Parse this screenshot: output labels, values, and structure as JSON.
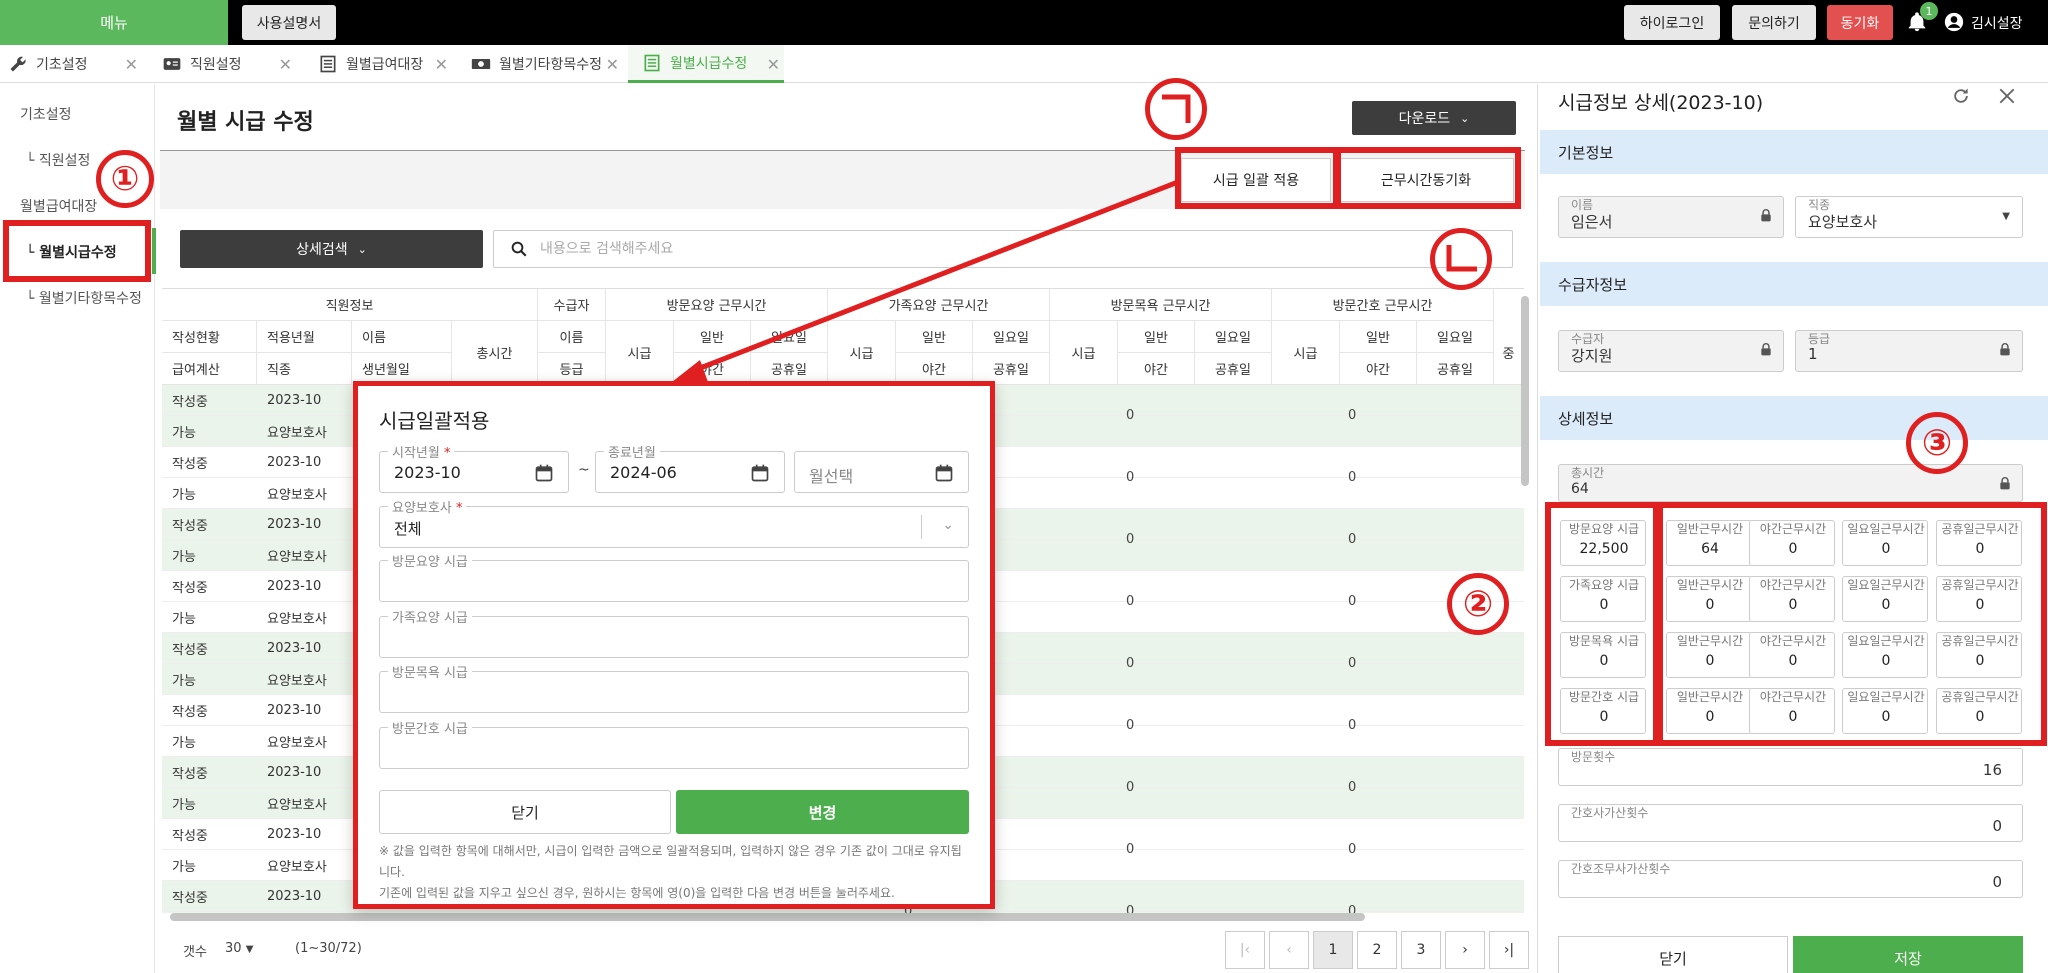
{
  "topbar": {
    "menu_label": "메뉴",
    "manual_label": "사용설명서",
    "hilogin_label": "하이로그인",
    "inquiry_label": "문의하기",
    "sync_label": "동기화",
    "notif_count": "1",
    "user_name": "김시설장",
    "colors": {
      "accent": "#5cb85c",
      "danger": "#e25050",
      "bar": "#000000"
    }
  },
  "tabs": [
    {
      "label": "기초설정",
      "icon": "wrench-icon"
    },
    {
      "label": "직원설정",
      "icon": "id-card-icon"
    },
    {
      "label": "월별급여대장",
      "icon": "ledger-icon"
    },
    {
      "label": "월별기타항목수정",
      "icon": "money-icon"
    },
    {
      "label": "월별시급수정",
      "icon": "list-icon",
      "active": true
    }
  ],
  "sidebar": {
    "items": [
      {
        "label": "기초설정"
      },
      {
        "label": "└ 직원설정"
      },
      {
        "label": "월별급여대장"
      },
      {
        "label": "└ 월별시급수정",
        "active": true
      },
      {
        "label": "└ 월별기타항목수정"
      }
    ]
  },
  "main": {
    "title": "월별 시급 수정",
    "download_label": "다운로드",
    "bulk_apply_label": "시급 일괄 적용",
    "sync_hours_label": "근무시간동기화",
    "detail_search_label": "상세검색",
    "search_placeholder": "내용으로 검색해주세요"
  },
  "grid": {
    "groups": [
      "직원정보",
      "수급자",
      "방문요양 근무시간",
      "가족요양 근무시간",
      "방문목욕 근무시간",
      "방문간호 근무시간"
    ],
    "header_row1": [
      "작성현황",
      "적용년월",
      "이름",
      "총시간",
      "이름",
      "시급",
      "일반",
      "일요일",
      "시급",
      "일반",
      "일요일",
      "시급",
      "일반",
      "일요일",
      "시급",
      "일반",
      "일요일",
      "중"
    ],
    "header_row2": [
      "급여계산",
      "직종",
      "생년월일",
      "등급",
      "야간",
      "공휴일",
      "야간",
      "공휴일",
      "야간",
      "공휴일",
      "야간",
      "공휴일"
    ],
    "rows": [
      {
        "status": "작성중",
        "month": "2023-10",
        "calc": "가능",
        "job": "요양보호사",
        "zero": "0"
      },
      {
        "status": "작성중",
        "month": "2023-10",
        "calc": "가능",
        "job": "요양보호사",
        "zero": "0"
      },
      {
        "status": "작성중",
        "month": "2023-10",
        "calc": "가능",
        "job": "요양보호사",
        "zero": "0"
      },
      {
        "status": "작성중",
        "month": "2023-10",
        "calc": "가능",
        "job": "요양보호사",
        "zero": "0"
      },
      {
        "status": "작성중",
        "month": "2023-10",
        "calc": "가능",
        "job": "요양보호사",
        "zero": "0"
      },
      {
        "status": "작성중",
        "month": "2023-10",
        "calc": "가능",
        "job": "요양보호사",
        "zero": "0"
      },
      {
        "status": "작성중",
        "month": "2023-10",
        "calc": "가능",
        "job": "요양보호사",
        "zero": "0"
      },
      {
        "status": "작성중",
        "month": "2023-10",
        "calc": "가능",
        "job": "요양보호사",
        "zero": "0"
      },
      {
        "status": "작성중",
        "month": "2023-10",
        "calc": "가능",
        "job": "요양보호사",
        "zero": "0"
      }
    ],
    "last_row": {
      "status": "작성중",
      "month": "2023-10"
    }
  },
  "pagination": {
    "count_label": "갯수",
    "count_value": "30",
    "range": "(1~30/72)",
    "pages": [
      "1",
      "2",
      "3"
    ],
    "current": "1"
  },
  "modal": {
    "title": "시급일괄적용",
    "start_label": "시작년월",
    "start_value": "2023-10",
    "end_label": "종료년월",
    "end_value": "2024-06",
    "tilde": "~",
    "month_select_placeholder": "월선택",
    "caregiver_label": "요양보호사",
    "caregiver_value": "전체",
    "visit_care_rate_label": "방문요양 시급",
    "family_care_rate_label": "가족요양 시급",
    "visit_bath_rate_label": "방문목욕 시급",
    "visit_nurse_rate_label": "방문간호 시급",
    "close_label": "닫기",
    "apply_label": "변경",
    "note1": "※ 값을 입력한 항목에 대해서만, 시급이 입력한 금액으로 일괄적용되며, 입력하지 않은 경우 기존 값이 그대로 유지됩니다.",
    "note2": "기존에 입력된 값을 지우고 싶으신 경우, 원하시는 항목에 영(0)을 입력한 다음 변경 버튼을 눌러주세요."
  },
  "rpanel": {
    "title": "시급정보 상세(2023-10)",
    "basic_section": "기본정보",
    "name_label": "이름",
    "name_value": "임은서",
    "job_label": "직종",
    "job_value": "요양보호사",
    "recipient_section": "수급자정보",
    "recipient_label": "수급자",
    "recipient_value": "강지원",
    "grade_label": "등급",
    "grade_value": "1",
    "detail_section": "상세정보",
    "total_label": "총시간",
    "total_value": "64",
    "rates": [
      {
        "label": "방문요양 시급",
        "value": "22,500",
        "normal": "64",
        "night": "0",
        "sunday": "0",
        "holiday": "0"
      },
      {
        "label": "가족요양 시급",
        "value": "0",
        "normal": "0",
        "night": "0",
        "sunday": "0",
        "holiday": "0"
      },
      {
        "label": "방문목욕 시급",
        "value": "0",
        "normal": "0",
        "night": "0",
        "sunday": "0",
        "holiday": "0"
      },
      {
        "label": "방문간호 시급",
        "value": "0",
        "normal": "0",
        "night": "0",
        "sunday": "0",
        "holiday": "0"
      }
    ],
    "normal_label": "일반근무시간",
    "night_label": "야간근무시간",
    "sunday_label": "일요일근무시간",
    "holiday_label": "공휴일근무시간",
    "count_partial_label": "방문횟수",
    "count_value": "16",
    "nurse_add_label": "간호사가산횟수",
    "nurse_add_value": "0",
    "nurse_aide_add_label": "간호조무사가산횟수",
    "nurse_aide_add_value": "0",
    "close_label": "닫기",
    "save_label": "저장"
  },
  "annotations": {
    "n1": "①",
    "n2": "②",
    "n3": "③"
  }
}
